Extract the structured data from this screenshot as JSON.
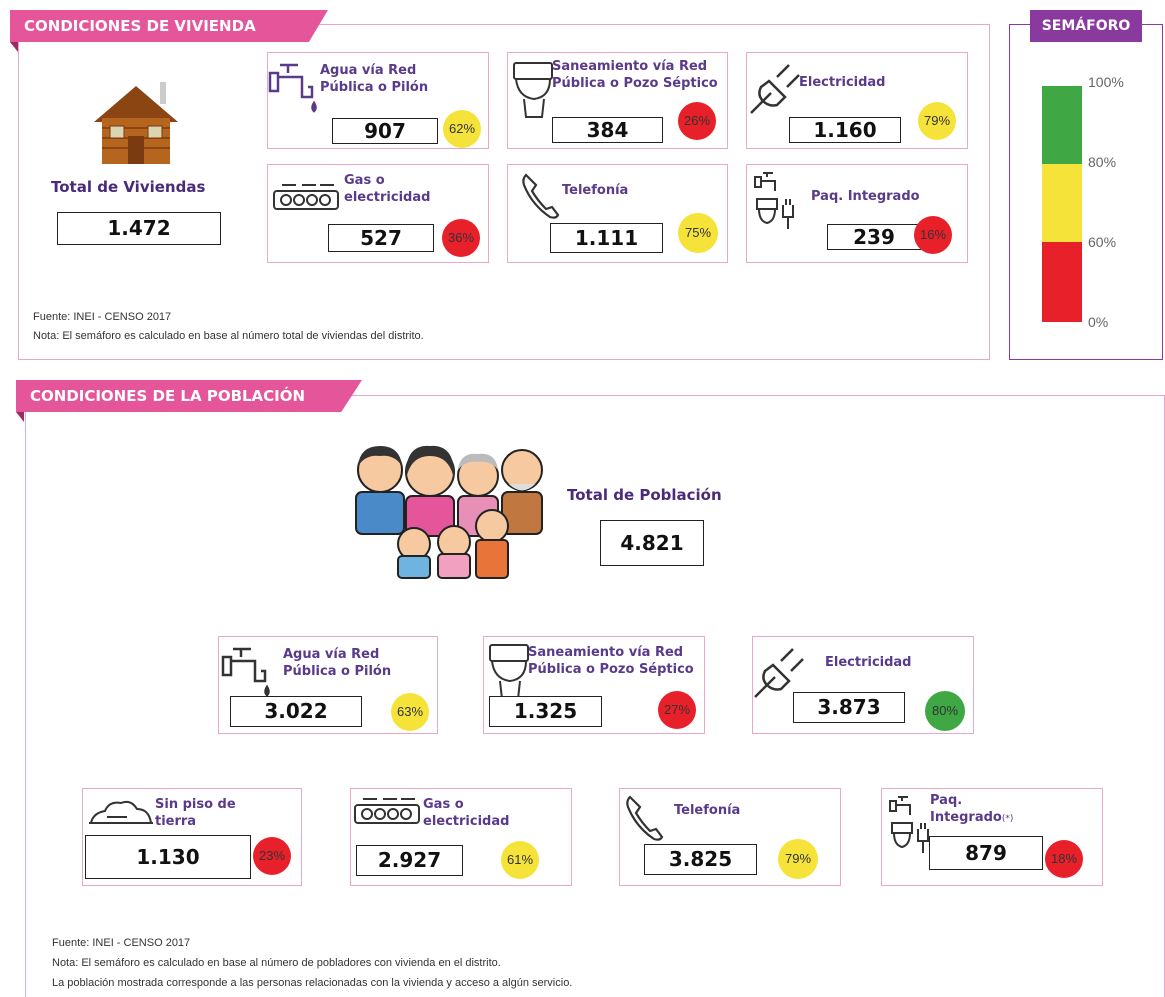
{
  "colors": {
    "accent": "#e5559a",
    "purple": "#8a3a9e",
    "red": "#e8202a",
    "yellow": "#f5e33a",
    "green": "#3fa845"
  },
  "vivienda": {
    "title": "CONDICIONES DE VIVIENDA",
    "total_label": "Total de Viviendas",
    "total_value": "1.472",
    "cards": [
      {
        "label": "Agua vía Red Pública o Pilón",
        "value": "907",
        "pct": "62%",
        "status": "yellow",
        "icon": "water-tap-icon"
      },
      {
        "label": "Saneamiento vía Red Pública o Pozo Séptico",
        "value": "384",
        "pct": "26%",
        "status": "red",
        "icon": "toilet-icon"
      },
      {
        "label": "Electricidad",
        "value": "1.160",
        "pct": "79%",
        "status": "yellow",
        "icon": "plug-icon"
      },
      {
        "label": "Gas o electricidad",
        "value": "527",
        "pct": "36%",
        "status": "red",
        "icon": "stove-icon"
      },
      {
        "label": "Telefonía",
        "value": "1.111",
        "pct": "75%",
        "status": "yellow",
        "icon": "phone-icon"
      },
      {
        "label": "Paq. Integrado",
        "value": "239",
        "pct": "16%",
        "status": "red",
        "icon": "package-icon"
      }
    ],
    "source": "Fuente: INEI - CENSO 2017",
    "note": "Nota: El semáforo es calculado en base al número total de viviendas del distrito."
  },
  "semaforo": {
    "title": "SEMÁFORO",
    "ticks": [
      "100%",
      "80%",
      "60%",
      "0%"
    ]
  },
  "poblacion": {
    "title": "CONDICIONES DE LA POBLACIÓN",
    "total_label": "Total de Población",
    "total_value": "4.821",
    "cards": [
      {
        "label": "Agua vía Red Pública o Pilón",
        "value": "3.022",
        "pct": "63%",
        "status": "yellow",
        "icon": "water-tap-icon"
      },
      {
        "label": "Saneamiento vía Red Pública o Pozo Séptico",
        "value": "1.325",
        "pct": "27%",
        "status": "red",
        "icon": "toilet-icon"
      },
      {
        "label": "Electricidad",
        "value": "3.873",
        "pct": "80%",
        "status": "green",
        "icon": "plug-icon"
      },
      {
        "label": "Sin piso de tierra",
        "value": "1.130",
        "pct": "23%",
        "status": "red",
        "icon": "floor-icon"
      },
      {
        "label": "Gas o electricidad",
        "value": "2.927",
        "pct": "61%",
        "status": "yellow",
        "icon": "stove-icon"
      },
      {
        "label": "Telefonía",
        "value": "3.825",
        "pct": "79%",
        "status": "yellow",
        "icon": "phone-icon"
      },
      {
        "label": "Paq. Integrado",
        "value": "879",
        "pct": "18%",
        "status": "red",
        "icon": "package-icon",
        "footnote": "(*)"
      }
    ],
    "source": "Fuente: INEI - CENSO 2017",
    "note": "Nota: El semáforo es calculado en base al número de pobladores con vivienda en el distrito.",
    "note2": "La población mostrada corresponde a las personas relacionadas con la vivienda y acceso a algún servicio."
  }
}
